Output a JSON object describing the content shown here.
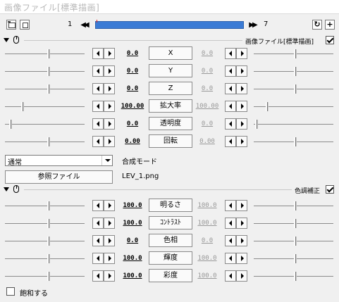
{
  "title": "画像ファイル[標準描画]",
  "toolbar": {
    "frame_start": "1",
    "frame_end": "7",
    "icons": [
      "camera-icon",
      "frame-icon",
      "prev-keyframe-icon",
      "next-keyframe-icon",
      "rotate-icon",
      "add-icon"
    ],
    "timeline_color": "#3a7bd5"
  },
  "section1": {
    "label": "画像ファイル[標準描画]",
    "enabled": true,
    "params": [
      {
        "label": "X",
        "value": "0.0",
        "end_value": "0.0"
      },
      {
        "label": "Y",
        "value": "0.0",
        "end_value": "0.0"
      },
      {
        "label": "Z",
        "value": "0.0",
        "end_value": "0.0"
      },
      {
        "label": "拡大率",
        "value": "100.00",
        "end_value": "100.00"
      },
      {
        "label": "透明度",
        "value": "0.0",
        "end_value": "0.0"
      },
      {
        "label": "回転",
        "value": "0.00",
        "end_value": "0.00"
      }
    ],
    "blend_mode": {
      "selected": "通常",
      "label": "合成モード"
    },
    "reference_button": "参照ファイル",
    "file_name": "LEV_1.png"
  },
  "section2": {
    "label": "色調補正",
    "enabled": true,
    "params": [
      {
        "label": "明るさ",
        "value": "100.0",
        "end_value": "100.0"
      },
      {
        "label": "ｺﾝﾄﾗｽﾄ",
        "value": "100.0",
        "end_value": "100.0"
      },
      {
        "label": "色相",
        "value": "0.0",
        "end_value": "0.0"
      },
      {
        "label": "輝度",
        "value": "100.0",
        "end_value": "100.0"
      },
      {
        "label": "彩度",
        "value": "100.0",
        "end_value": "100.0"
      }
    ],
    "saturate_label": "飽和する",
    "saturate_checked": false
  }
}
